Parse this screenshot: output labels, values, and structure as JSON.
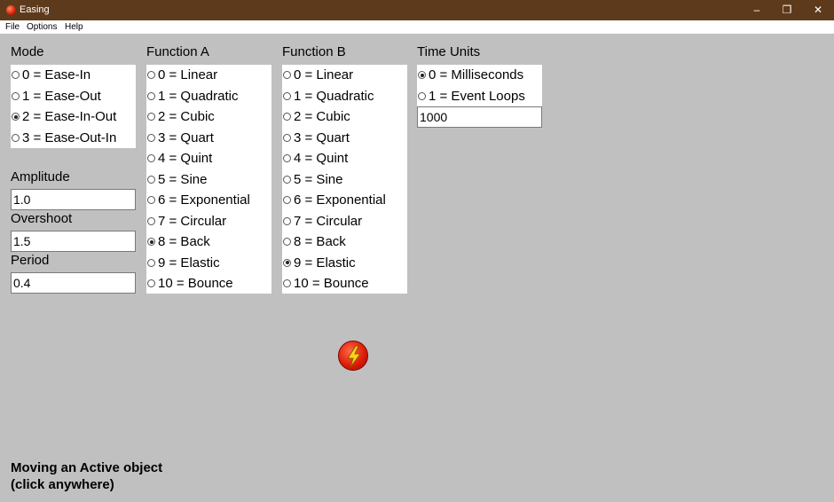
{
  "window": {
    "title": "Easing",
    "min": "–",
    "max": "❐",
    "close": "✕"
  },
  "menu": [
    "File",
    "Options",
    "Help"
  ],
  "mode": {
    "label": "Mode",
    "options": [
      "0 = Ease-In",
      "1 = Ease-Out",
      "2 = Ease-In-Out",
      "3 = Ease-Out-In"
    ],
    "selected": 2
  },
  "function_a": {
    "label": "Function A",
    "options": [
      "0 = Linear",
      "1 = Quadratic",
      "2 = Cubic",
      "3 = Quart",
      "4 = Quint",
      "5 = Sine",
      "6 = Exponential",
      "7 = Circular",
      "8 = Back",
      "9 = Elastic",
      "10 = Bounce"
    ],
    "selected": 8
  },
  "function_b": {
    "label": "Function B",
    "options": [
      "0 = Linear",
      "1 = Quadratic",
      "2 = Cubic",
      "3 = Quart",
      "4 = Quint",
      "5 = Sine",
      "6 = Exponential",
      "7 = Circular",
      "8 = Back",
      "9 = Elastic",
      "10 = Bounce"
    ],
    "selected": 9
  },
  "time_units": {
    "label": "Time Units",
    "options": [
      "0 = Milliseconds",
      "1 = Event Loops"
    ],
    "selected": 0,
    "value": "1000"
  },
  "amplitude": {
    "label": "Amplitude",
    "value": "1.0"
  },
  "overshoot": {
    "label": "Overshoot",
    "value": "1.5"
  },
  "period": {
    "label": "Period",
    "value": "0.4"
  },
  "active_object": {
    "icon": "lightning-bolt-icon",
    "color": "#e01c08"
  },
  "status": {
    "line1": "Moving an Active object",
    "line2": "(click anywhere)"
  }
}
